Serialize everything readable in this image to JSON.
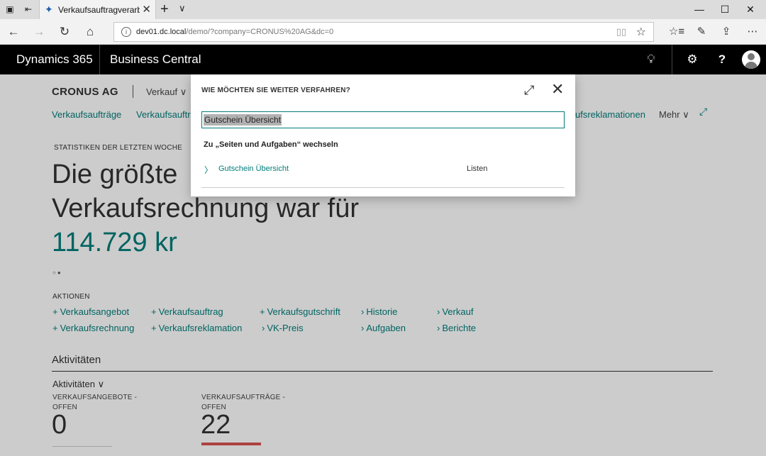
{
  "browser": {
    "tab_title": "Verkaufsauftragverarbei",
    "url_host": "dev01.dc.local",
    "url_path": "/demo/?company=CRONUS%20AG&dc=0"
  },
  "appbar": {
    "brand": "Dynamics 365",
    "app_name": "Business Central"
  },
  "page": {
    "company": "CRONUS AG",
    "role_menu": "Verkauf",
    "nav": {
      "item1": "Verkaufsaufträge",
      "item2": "Verkaufsauftr",
      "item3": "ufsreklamationen",
      "more": "Mehr"
    },
    "stats_caption": "STATISTIKEN DER LETZTEN WOCHE",
    "headline_line1": "Die größte",
    "headline_line2": "Verkaufsrechnung war für",
    "headline_value": "114.729 kr",
    "actions_caption": "AKTIONEN",
    "actions": {
      "a1": "Verkaufsangebot",
      "a2": "Verkaufsauftrag",
      "a3": "Verkaufsgutschrift",
      "a4": "Historie",
      "a5": "Verkauf",
      "a6": "Verkaufsrechnung",
      "a7": "Verkaufsreklamation",
      "a8": "VK-Preis",
      "a9": "Aufgaben",
      "a10": "Berichte"
    },
    "activities_title": "Aktivitäten",
    "activities_menu": "Aktivitäten",
    "tiles": {
      "t1_caption_1": "VERKAUFSANGEBOTE -",
      "t1_caption_2": "OFFEN",
      "t1_value": "0",
      "t2_caption_1": "VERKAUFSAUFTRÄGE -",
      "t2_caption_2": "OFFEN",
      "t2_value": "22",
      "t2_bar_color": "#d9534f"
    }
  },
  "dialog": {
    "title": "WIE MÖCHTEN SIE WEITER VERFAHREN?",
    "search_value": "Gutschein Übersicht",
    "group_label": "Zu „Seiten und Aufgaben“ wechseln",
    "result_label": "Gutschein Übersicht",
    "result_category": "Listen"
  },
  "colors": {
    "accent": "#007d7a",
    "appbar": "#000000"
  }
}
